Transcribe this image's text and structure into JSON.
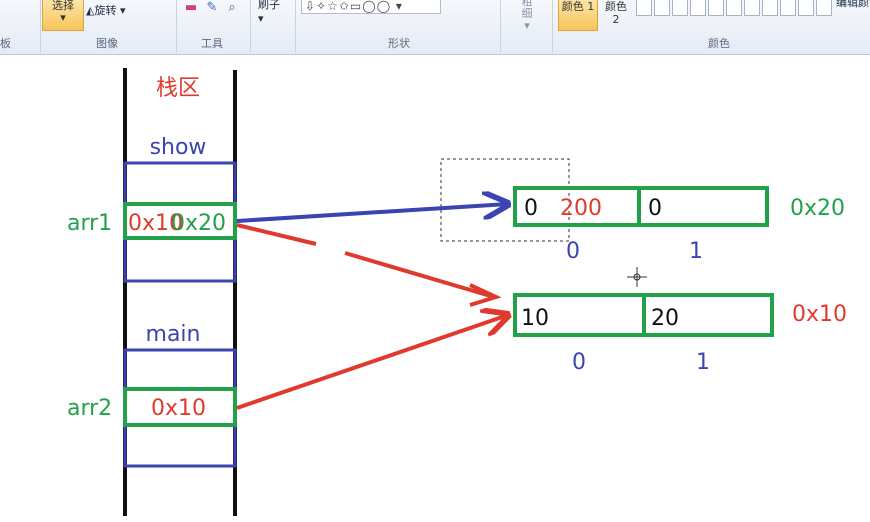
{
  "ribbon": {
    "board_label": "板",
    "select_label": "选择",
    "rotate_label": "旋转",
    "image_group": "图像",
    "tools_group": "工具",
    "brush_label": "刷子",
    "shapes_group": "形状",
    "outline_label": "粗细",
    "color1_label": "颜色 1",
    "color2_label": "颜色 2",
    "edit_colors_label": "编辑颜色",
    "colors_group": "颜色"
  },
  "diagram": {
    "stack_title": "栈区",
    "show_frame": "show",
    "main_frame": "main",
    "arr1_label": "arr1",
    "arr1_old_value": "0x10",
    "arr1_new_value": "0x20",
    "arr2_label": "arr2",
    "arr2_value": "0x10",
    "array_top": {
      "address": "0x20",
      "cell0_old": "0",
      "cell0_new": "200",
      "cell1": "0",
      "index0": "0",
      "index1": "1"
    },
    "array_bottom": {
      "address": "0x10",
      "cell0": "10",
      "cell1": "20",
      "index0": "0",
      "index1": "1"
    }
  },
  "colors": {
    "green": "#22a04a",
    "red": "#e03a2e",
    "blue": "#3b44b0",
    "black": "#111111"
  }
}
